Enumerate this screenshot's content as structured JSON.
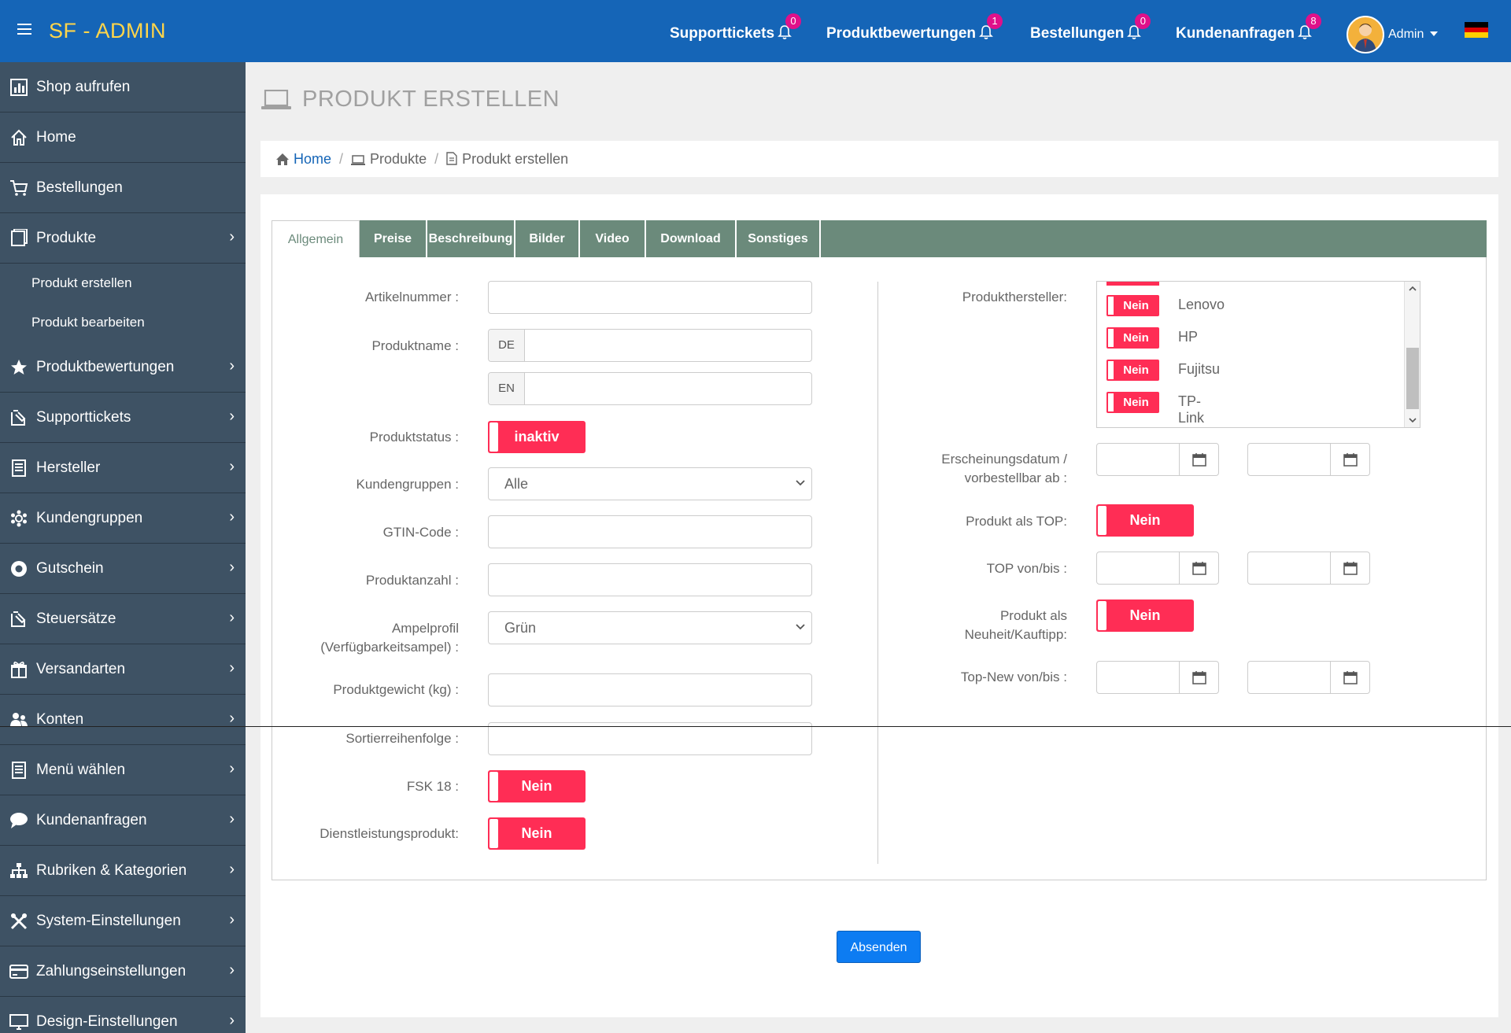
{
  "topbar": {
    "brand": "SF - ADMIN",
    "nav": [
      {
        "label": "Supporttickets",
        "count": "0"
      },
      {
        "label": "Produktbewertungen",
        "count": "1"
      },
      {
        "label": "Bestellungen",
        "count": "0"
      },
      {
        "label": "Kundenanfragen",
        "count": "8"
      }
    ],
    "user": "Admin"
  },
  "sidebar": {
    "items": [
      {
        "label": "Shop aufrufen"
      },
      {
        "label": "Home"
      },
      {
        "label": "Bestellungen"
      },
      {
        "label": "Produkte"
      },
      {
        "label": "Produktbewertungen"
      },
      {
        "label": "Supporttickets"
      },
      {
        "label": "Hersteller"
      },
      {
        "label": "Kundengruppen"
      },
      {
        "label": "Gutschein"
      },
      {
        "label": "Steuersätze"
      },
      {
        "label": "Versandarten"
      },
      {
        "label": "Konten"
      },
      {
        "label": "Menü wählen"
      },
      {
        "label": "Kundenanfragen"
      },
      {
        "label": "Rubriken & Kategorien"
      },
      {
        "label": "System-Einstellungen"
      },
      {
        "label": "Zahlungseinstellungen"
      },
      {
        "label": "Design-Einstellungen"
      }
    ],
    "subitems": [
      {
        "label": "Produkt erstellen"
      },
      {
        "label": "Produkt bearbeiten"
      }
    ]
  },
  "page": {
    "title": "PRODUKT ERSTELLEN",
    "breadcrumb": [
      "Home",
      "Produkte",
      "Produkt erstellen"
    ]
  },
  "tabs": [
    "Allgemein",
    "Preise",
    "Beschreibung",
    "Bilder",
    "Video",
    "Download",
    "Sonstiges"
  ],
  "form_left": {
    "artikelnummer": "Artikelnummer :",
    "produktname": "Produktname :",
    "lang_de": "DE",
    "lang_en": "EN",
    "produktstatus": "Produktstatus :",
    "produktstatus_value": "inaktiv",
    "kundengruppen": "Kundengruppen :",
    "kundengruppen_value": "Alle",
    "gtin": "GTIN-Code :",
    "produktanzahl": "Produktanzahl :",
    "ampel_1": "Ampelprofil",
    "ampel_2": "(Verfügbarkeitsampel) :",
    "ampel_value": "Grün",
    "gewicht": "Produktgewicht (kg) :",
    "sortier": "Sortierreihenfolge :",
    "fsk": "FSK 18 :",
    "fsk_value": "Nein",
    "dienst": "Dienstleistungsprodukt:",
    "dienst_value": "Nein"
  },
  "form_right": {
    "hersteller_label": "Produkthersteller:",
    "hersteller": [
      {
        "state": "Nein",
        "name": "Lenovo"
      },
      {
        "state": "Nein",
        "name": "HP"
      },
      {
        "state": "Nein",
        "name": "Fujitsu"
      },
      {
        "state": "Nein",
        "name": "TP-Link"
      }
    ],
    "erschein_1": "Erscheinungsdatum /",
    "erschein_2": "vorbestellbar ab :",
    "top_label": "Produkt als TOP:",
    "top_value": "Nein",
    "top_range": "TOP von/bis :",
    "neu_1": "Produkt als",
    "neu_2": "Neuheit/Kauftipp:",
    "neu_value": "Nein",
    "topnew_range": "Top-New von/bis :"
  },
  "submit_label": "Absenden",
  "colors": {
    "topbar": "#1565b7",
    "brand": "#ffd54a",
    "sidebar": "#3e5264",
    "tabbar": "#6b8a7b",
    "toggle": "#ff2d55",
    "badge": "#e0108a",
    "submit": "#0d7cf2"
  }
}
